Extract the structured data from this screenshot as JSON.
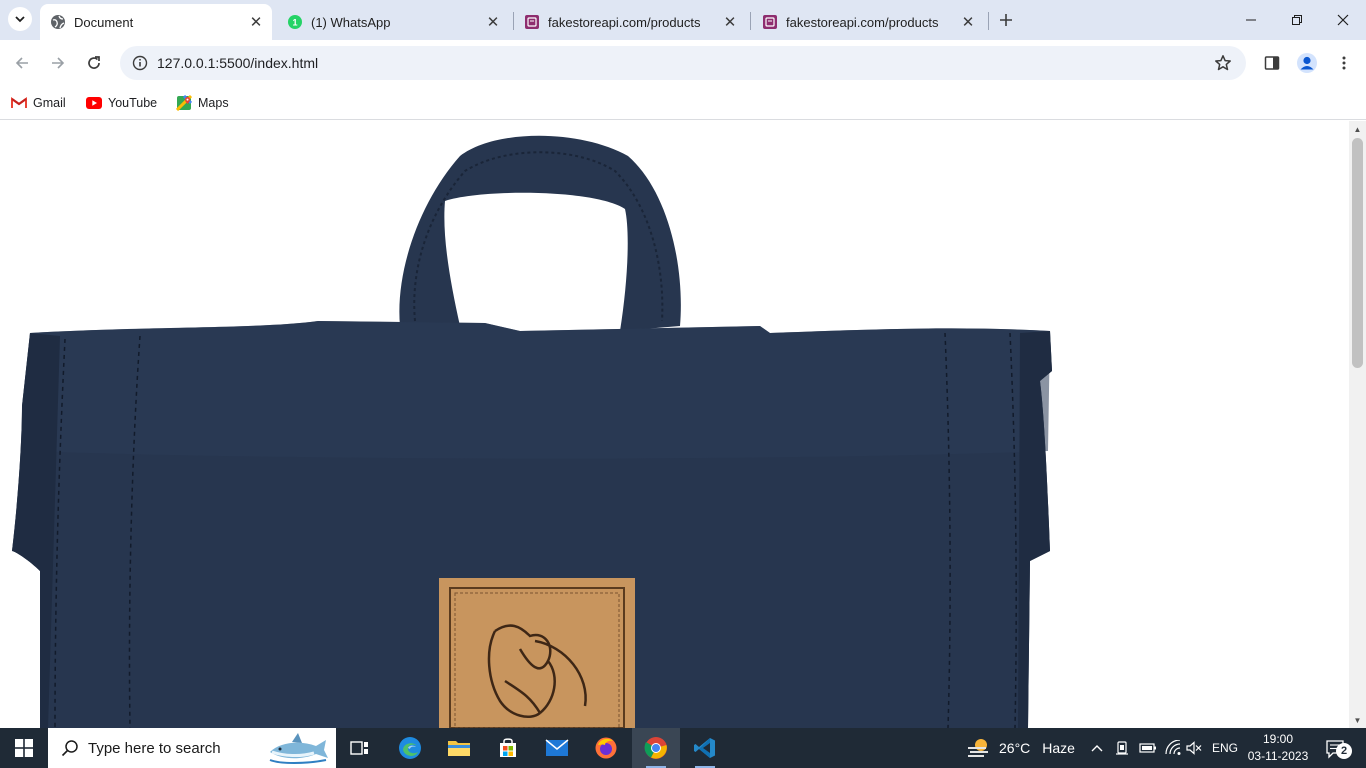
{
  "browser": {
    "tabs": [
      {
        "title": "Document",
        "favicon": "globe-icon",
        "active": true
      },
      {
        "title": "(1) WhatsApp",
        "favicon": "whatsapp-icon",
        "active": false
      },
      {
        "title": "fakestoreapi.com/products",
        "favicon": "fakestore-icon",
        "active": false
      },
      {
        "title": "fakestoreapi.com/products",
        "favicon": "fakestore-icon",
        "active": false
      }
    ],
    "url": "127.0.0.1:5500/index.html",
    "bookmarks": [
      {
        "label": "Gmail",
        "icon": "gmail-icon"
      },
      {
        "label": "YouTube",
        "icon": "youtube-icon"
      },
      {
        "label": "Maps",
        "icon": "maps-icon"
      }
    ]
  },
  "page": {
    "image": "navy-backpack-product-photo"
  },
  "taskbar": {
    "search_placeholder": "Type here to search",
    "weather_temp": "26°C",
    "weather_desc": "Haze",
    "language": "ENG",
    "time": "19:00",
    "date": "03-11-2023",
    "notification_count": "2"
  },
  "colors": {
    "tabstrip": "#dfe6f3",
    "backpack": "#27364f",
    "patch": "#c8955e",
    "taskbar": "#1f2a36"
  }
}
